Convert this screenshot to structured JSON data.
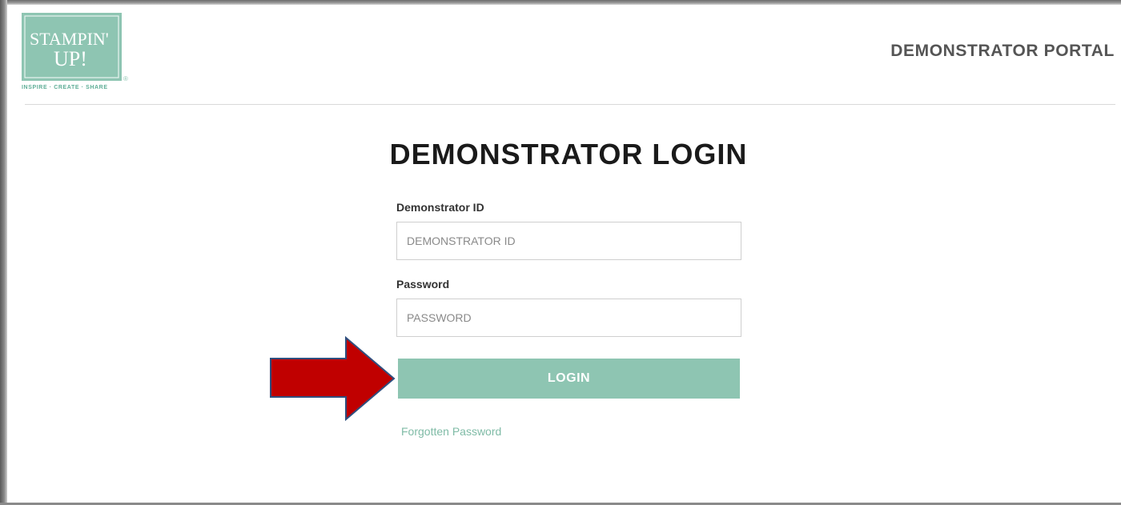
{
  "header": {
    "logo": {
      "line1": "STAMPIN'",
      "line2": "UP!",
      "registered_mark": "®",
      "tagline": "INSPIRE · CREATE · SHARE"
    },
    "portal_title": "DEMONSTRATOR PORTAL"
  },
  "main": {
    "title": "DEMONSTRATOR LOGIN",
    "demonstrator_id": {
      "label": "Demonstrator ID",
      "placeholder": "DEMONSTRATOR ID",
      "value": ""
    },
    "password": {
      "label": "Password",
      "placeholder": "PASSWORD",
      "value": ""
    },
    "login_button": "LOGIN",
    "forgot_link": "Forgotten Password"
  },
  "annotation": {
    "icon": "right-arrow-icon",
    "color": "#c00000"
  },
  "colors": {
    "brand": "#8ec5b2",
    "link": "#7fbba6",
    "text_dark": "#1a1a1a"
  }
}
